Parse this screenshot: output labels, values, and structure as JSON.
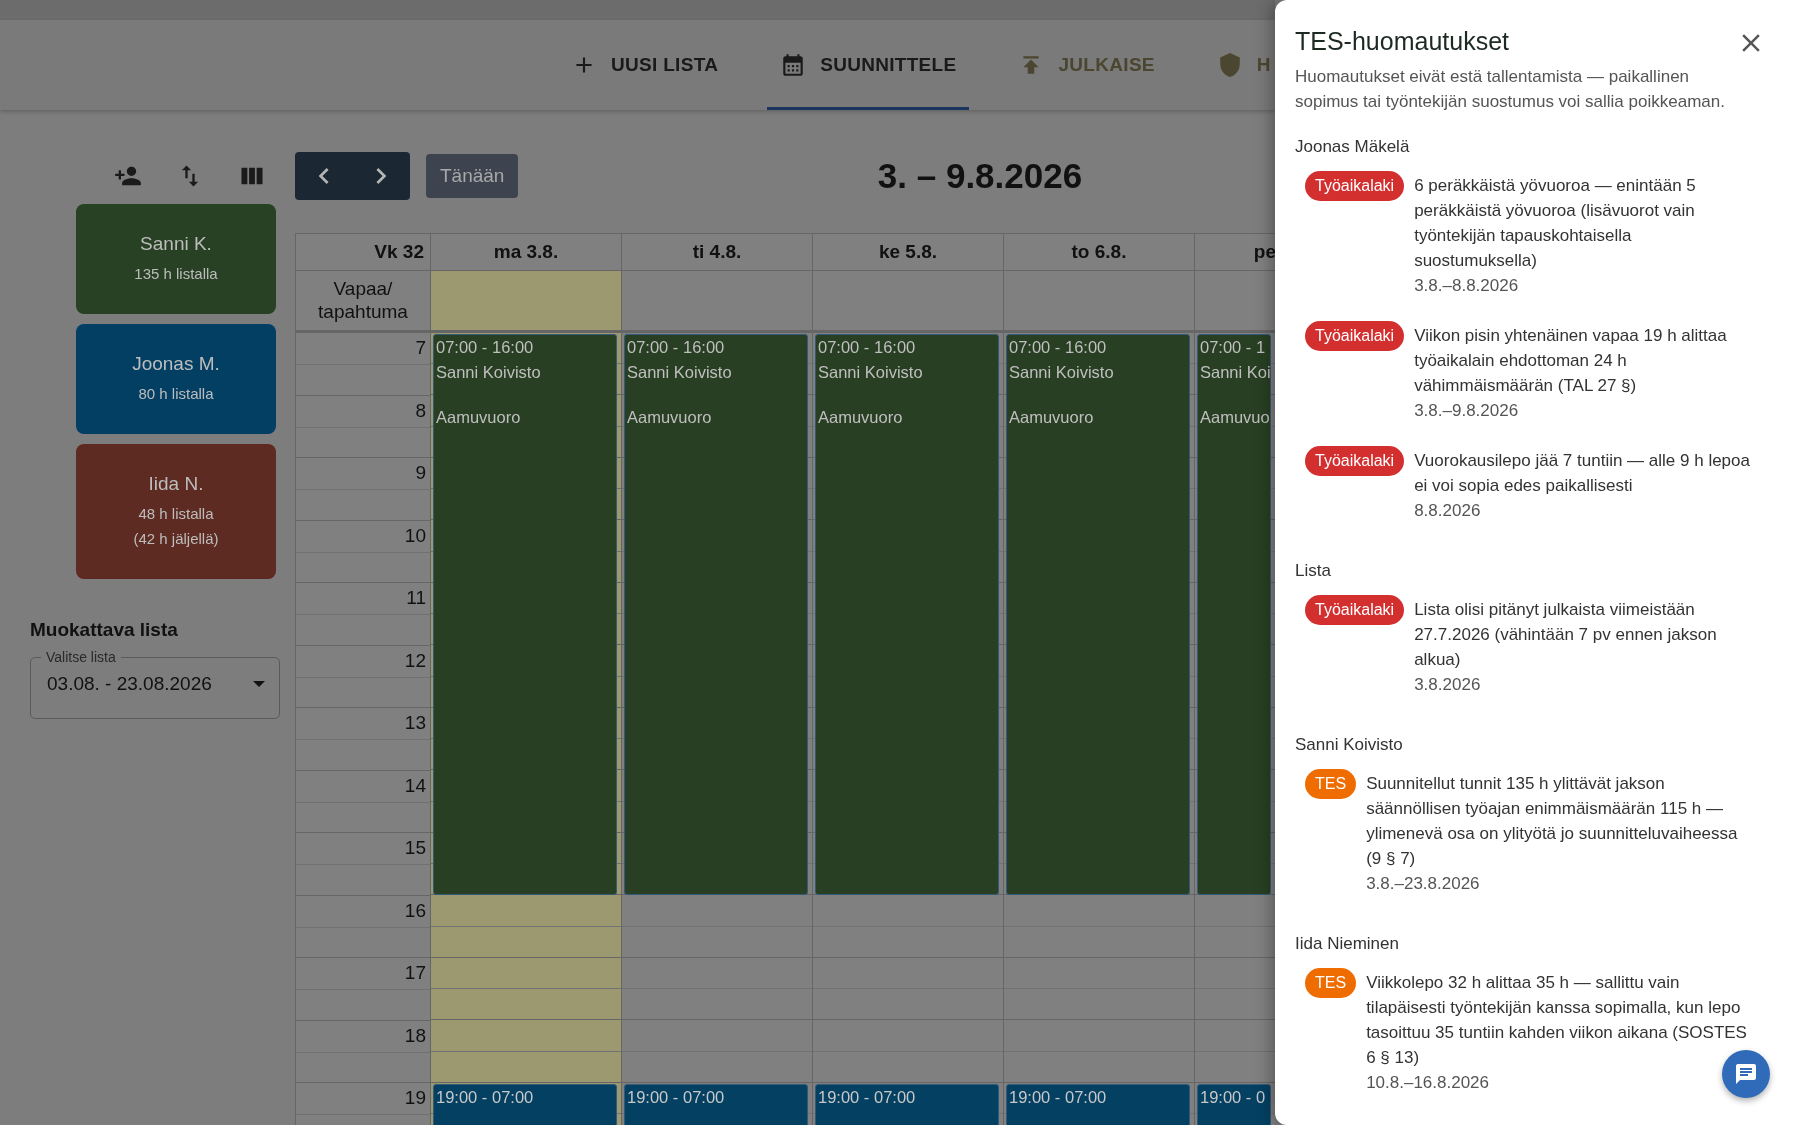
{
  "app_bar": {
    "tabs": [
      {
        "label": "UUSI LISTA",
        "selected": false,
        "disabled": false
      },
      {
        "label": "SUUNNITTELE",
        "selected": true,
        "disabled": false
      },
      {
        "label": "JULKAISE",
        "selected": false,
        "disabled": true
      },
      {
        "label": "H",
        "selected": false,
        "disabled": true
      }
    ]
  },
  "sidebar": {
    "employees": [
      {
        "name": "Sanni K.",
        "hours": "135 h listalla",
        "color": "#284024"
      },
      {
        "name": "Joonas M.",
        "hours": "80 h listalla",
        "color": "#033f63"
      },
      {
        "name": "Iida N.",
        "hours": "48 h listalla",
        "remaining": "(42 h jäljellä)",
        "color": "#5d2b21"
      }
    ],
    "list_select": {
      "heading": "Muokattava lista",
      "label": "Valitse lista",
      "value": "03.08. - 23.08.2026"
    }
  },
  "calendar": {
    "today_button": "Tänään",
    "title": "3. – 9.8.2026",
    "week": "Vk 32",
    "allday_label": "Vapaa/ tapahtuma",
    "hours": [
      "7",
      "8",
      "9",
      "10",
      "11",
      "12",
      "13",
      "14",
      "15",
      "16",
      "17",
      "18",
      "19"
    ],
    "days": [
      {
        "label": "ma 3.8.",
        "highlighted": true,
        "shifts": [
          {
            "kind": "morning",
            "time": "07:00 - 16:00",
            "name": "Sanni Koivisto",
            "type": "Aamuvuoro"
          },
          {
            "kind": "night",
            "time": "19:00 - 07:00"
          }
        ]
      },
      {
        "label": "ti 4.8.",
        "highlighted": false,
        "shifts": [
          {
            "kind": "morning",
            "time": "07:00 - 16:00",
            "name": "Sanni Koivisto",
            "type": "Aamuvuoro"
          },
          {
            "kind": "night",
            "time": "19:00 - 07:00"
          }
        ]
      },
      {
        "label": "ke 5.8.",
        "highlighted": false,
        "shifts": [
          {
            "kind": "morning",
            "time": "07:00 - 16:00",
            "name": "Sanni Koivisto",
            "type": "Aamuvuoro"
          },
          {
            "kind": "night",
            "time": "19:00 - 07:00"
          }
        ]
      },
      {
        "label": "to 6.8.",
        "highlighted": false,
        "shifts": [
          {
            "kind": "morning",
            "time": "07:00 - 16:00",
            "name": "Sanni Koivisto",
            "type": "Aamuvuoro"
          },
          {
            "kind": "night",
            "time": "19:00 - 07:00"
          }
        ]
      },
      {
        "label": "pe",
        "highlighted": false,
        "shifts": [
          {
            "kind": "morning",
            "time": "07:00 - 1",
            "name": "Sanni Koi",
            "type": "Aamuvuo"
          },
          {
            "kind": "night",
            "time": "19:00 - 0"
          }
        ]
      }
    ]
  },
  "drawer": {
    "title": "TES-huomautukset",
    "subtitle": "Huomautukset eivät estä tallentamista — paikallinen sopimus tai työntekijän suostumus voi sallia poikkeaman.",
    "groups": [
      {
        "name": "Joonas Mäkelä",
        "notes": [
          {
            "kind": "law",
            "tag": "Työaikalaki",
            "text": "6 peräkkäistä yövuoroa — enintään 5 peräkkäistä yövuoroa (lisävuorot vain työntekijän tapauskohtaisella suostumuksella)",
            "dates": "3.8.–8.8.2026"
          },
          {
            "kind": "law",
            "tag": "Työaikalaki",
            "text": "Viikon pisin yhtenäinen vapaa 19 h alittaa työaikalain ehdottoman 24 h vähimmäismäärän (TAL 27 §)",
            "dates": "3.8.–9.8.2026"
          },
          {
            "kind": "law",
            "tag": "Työaikalaki",
            "text": "Vuorokausilepo jää 7 tuntiin — alle 9 h lepoa ei voi sopia edes paikallisesti",
            "dates": "8.8.2026"
          }
        ]
      },
      {
        "name": "Lista",
        "notes": [
          {
            "kind": "law",
            "tag": "Työaikalaki",
            "text": "Lista olisi pitänyt julkaista viimeistään 27.7.2026 (vähintään 7 pv ennen jakson alkua)",
            "dates": "3.8.2026"
          }
        ]
      },
      {
        "name": "Sanni Koivisto",
        "notes": [
          {
            "kind": "tes",
            "tag": "TES",
            "text": "Suunnitellut tunnit 135 h ylittävät jakson säännöllisen työajan enimmäismäärän 115 h — ylimenevä osa on ylityötä jo suunnitteluvaiheessa (9 § 7)",
            "dates": "3.8.–23.8.2026"
          }
        ]
      },
      {
        "name": "Iida Nieminen",
        "notes": [
          {
            "kind": "tes",
            "tag": "TES",
            "text": "Viikkolepo 32 h alittaa 35 h — sallittu vain tilapäisesti työntekijän kanssa sopimalla, kun lepo tasoittuu 35 tuntiin kahden viikon aikana (SOSTES 6 § 13)",
            "dates": "10.8.–16.8.2026"
          }
        ]
      }
    ]
  }
}
